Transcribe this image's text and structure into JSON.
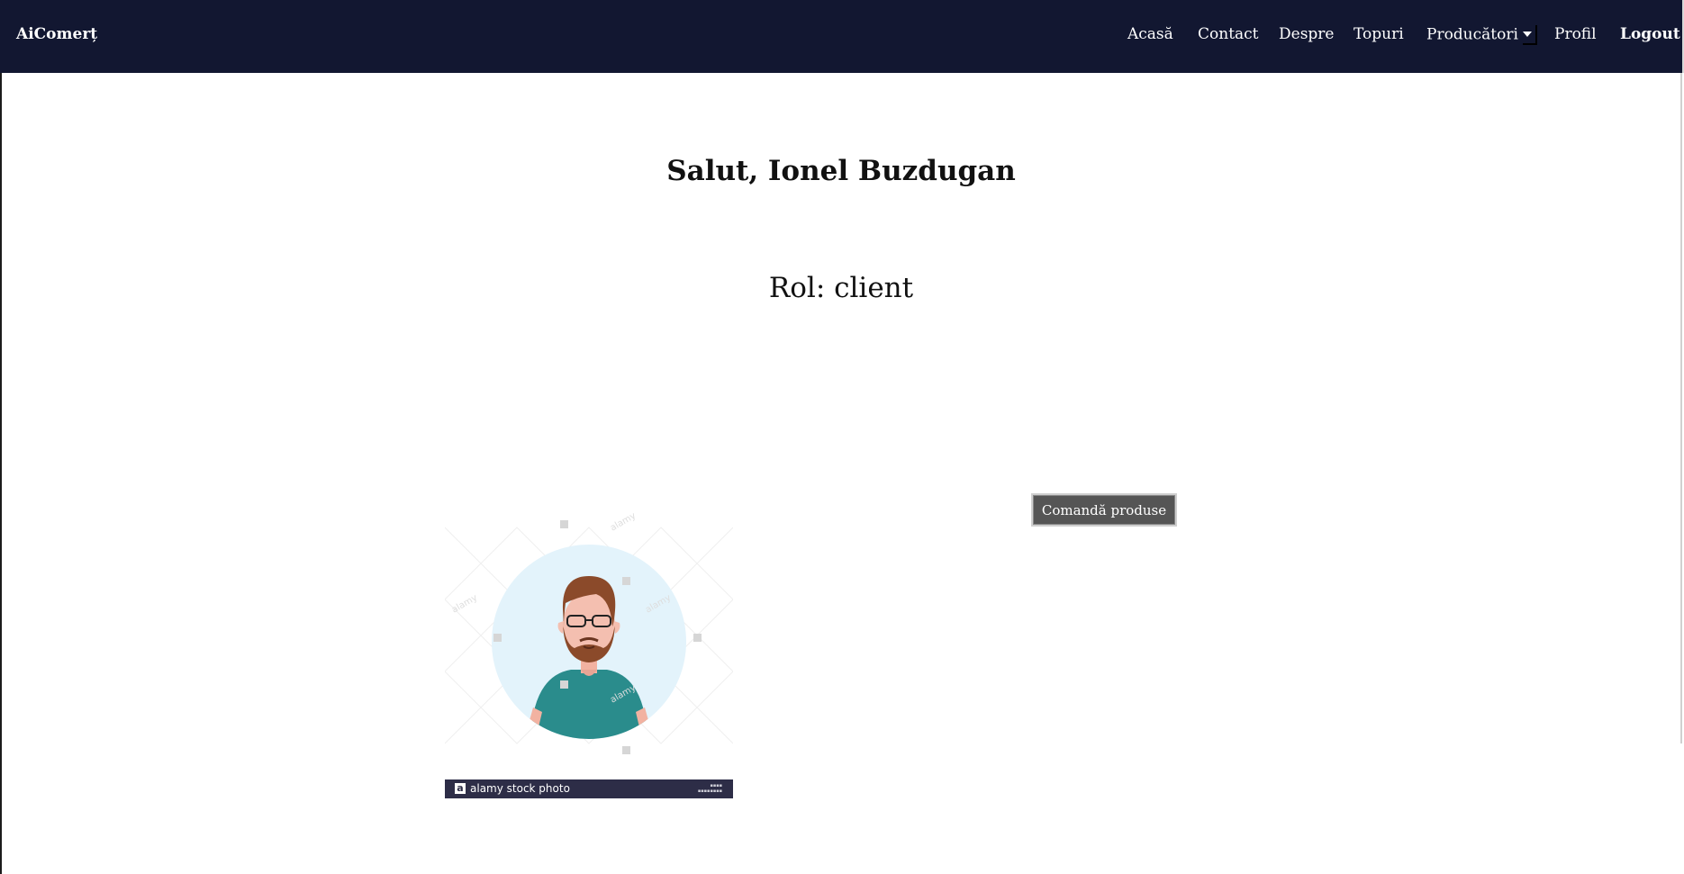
{
  "nav": {
    "brand": "AiComerț",
    "items": [
      "Acasă",
      "Contact",
      "Despre",
      "Topuri",
      "Producători",
      "Profil",
      "Logout"
    ]
  },
  "profile": {
    "greeting": "Salut, Ionel Buzdugan",
    "role": "Rol: client"
  },
  "avatar": {
    "stock_label": "alamy stock photo",
    "stock_logo": "a",
    "watermark": "alamy"
  },
  "actions": {
    "order_label": "Comandă produse"
  },
  "colors": {
    "navbar": "#121731",
    "button": "#555555",
    "avatar_bg": "#e3f3fb",
    "shirt": "#2a8c8c",
    "hair": "#8b4a2a"
  }
}
